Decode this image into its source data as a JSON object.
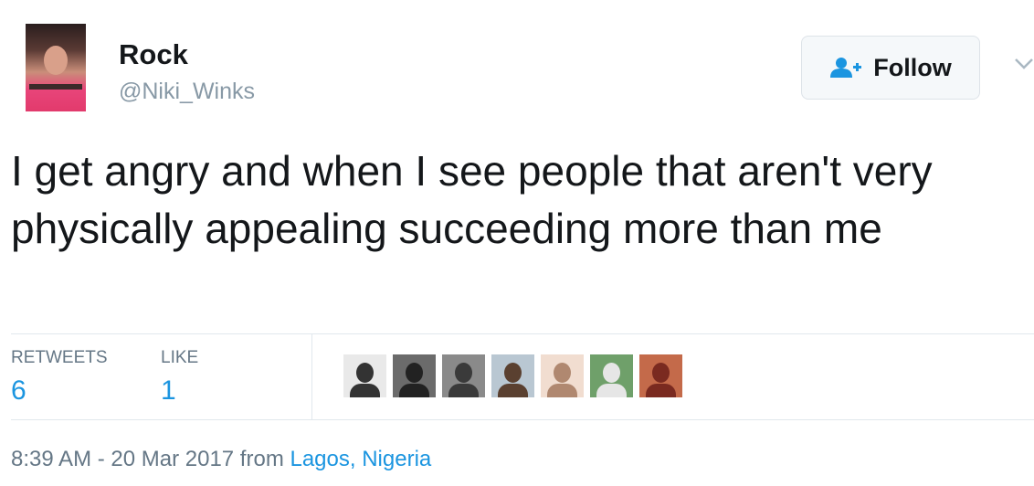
{
  "author": {
    "name": "Rock",
    "handle": "@Niki_Winks"
  },
  "follow_button": {
    "label": "Follow",
    "icon": "add-user-icon"
  },
  "menu_icon": "chevron-down-icon",
  "tweet": {
    "text": "I get angry and when I see people that aren't very physically appealing succeeding more than me"
  },
  "stats": {
    "retweets_label": "RETWEETS",
    "retweets_count": "6",
    "likes_label": "LIKE",
    "likes_count": "1"
  },
  "likers": [
    {
      "bg": "#e9e9e9",
      "fg": "#333333"
    },
    {
      "bg": "#6b6b6b",
      "fg": "#222222"
    },
    {
      "bg": "#8a8a8a",
      "fg": "#3a3a3a"
    },
    {
      "bg": "#b9c7d2",
      "fg": "#5a4030"
    },
    {
      "bg": "#f1ddd0",
      "fg": "#b08870"
    },
    {
      "bg": "#6fa06a",
      "fg": "#e6e6e6"
    },
    {
      "bg": "#c46a4a",
      "fg": "#7a2a20"
    }
  ],
  "meta": {
    "timestamp": "8:39 AM - 20 Mar 2017 from ",
    "location": "Lagos, Nigeria"
  },
  "colors": {
    "link": "#1b95e0",
    "secondary_text": "#657786",
    "handle_text": "#8899a6",
    "divider": "#e1e8ed"
  }
}
